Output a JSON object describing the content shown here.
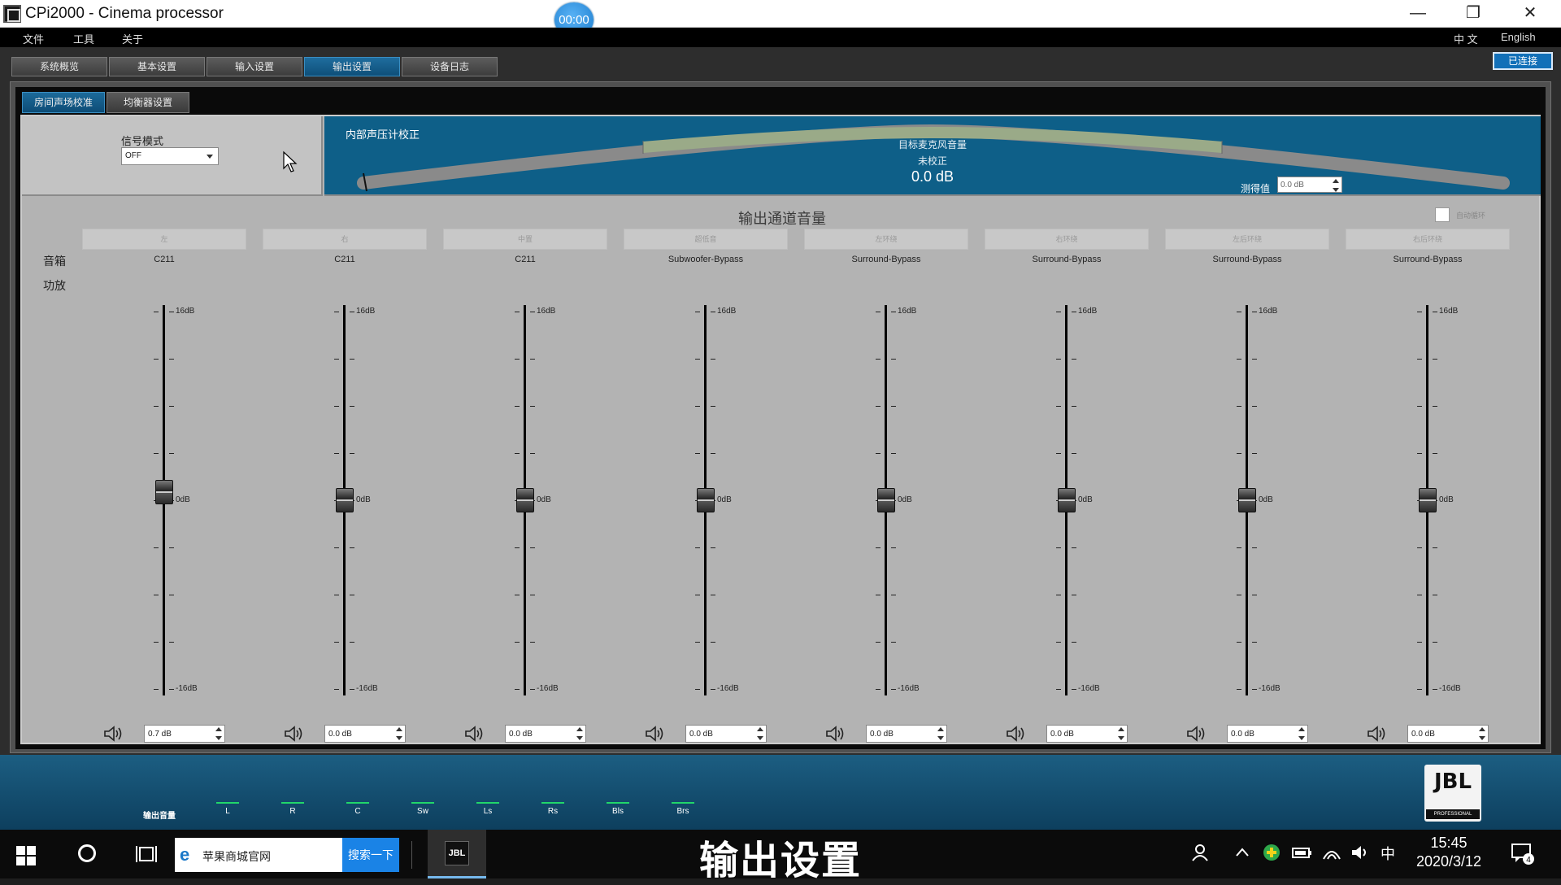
{
  "window": {
    "title": "CPi2000 - Cinema processor",
    "timer": "00:00"
  },
  "menu": {
    "items": [
      "文件",
      "工具",
      "关于"
    ],
    "lang_cn": "中 文",
    "lang_en": "English"
  },
  "tabs": {
    "items": [
      "系统概览",
      "基本设置",
      "输入设置",
      "输出设置",
      "设备日志"
    ],
    "active": "输出设置",
    "connected": "已连接"
  },
  "subtabs": {
    "items": [
      "房间声场校准",
      "均衡器设置"
    ],
    "active": "房间声场校准"
  },
  "signal": {
    "label": "信号模式",
    "value": "OFF"
  },
  "spl": {
    "label": "内部声压计校正",
    "target_label": "目标麦克风音量",
    "status": "未校正",
    "value": "0.0 dB",
    "measured_label": "测得值",
    "measured_value": "0.0 dB"
  },
  "output": {
    "section_title": "输出通道音量",
    "autoloop_label": "自动循环",
    "row_speaker": "音箱",
    "row_amp": "功放",
    "scale_top": "16dB",
    "scale_mid": "0dB",
    "scale_bottom": "-16dB",
    "range_db": [
      -16,
      16
    ],
    "channels": [
      {
        "name": "左",
        "speaker": "C211",
        "gain": "0.7 dB",
        "gain_db": 0.7
      },
      {
        "name": "右",
        "speaker": "C211",
        "gain": "0.0 dB",
        "gain_db": 0.0
      },
      {
        "name": "中置",
        "speaker": "C211",
        "gain": "0.0 dB",
        "gain_db": 0.0
      },
      {
        "name": "超低音",
        "speaker": "Subwoofer-Bypass",
        "gain": "0.0 dB",
        "gain_db": 0.0
      },
      {
        "name": "左环绕",
        "speaker": "Surround-Bypass",
        "gain": "0.0 dB",
        "gain_db": 0.0
      },
      {
        "name": "右环绕",
        "speaker": "Surround-Bypass",
        "gain": "0.0 dB",
        "gain_db": 0.0
      },
      {
        "name": "左后环绕",
        "speaker": "Surround-Bypass",
        "gain": "0.0 dB",
        "gain_db": 0.0
      },
      {
        "name": "右后环绕",
        "speaker": "Surround-Bypass",
        "gain": "0.0 dB",
        "gain_db": 0.0
      }
    ]
  },
  "footer": {
    "output_label": "输出音量",
    "meters": [
      "L",
      "R",
      "C",
      "Sw",
      "Ls",
      "Rs",
      "Bls",
      "Brs"
    ],
    "brand": "JBL",
    "brand_sub": "PROFESSIONAL"
  },
  "taskbar": {
    "search_text": "苹果商城官网",
    "search_button": "搜索一下",
    "app_label": "JBL",
    "caption": "输出设置",
    "ime": "中",
    "time": "15:45",
    "date": "2020/3/12",
    "notifications": "4"
  },
  "colors": {
    "accent_blue": "#0e5f88",
    "tab_active": "#1f6d9e",
    "meter_green": "#21d66a"
  }
}
